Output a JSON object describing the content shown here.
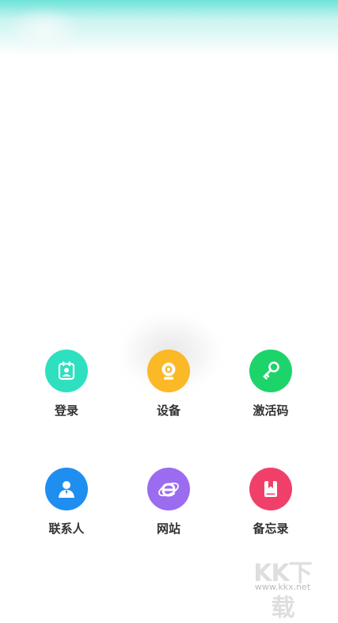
{
  "colors": {
    "login": "#2ee0c0",
    "device": "#fbb827",
    "activation": "#1dd46b",
    "contacts": "#1f8ef1",
    "website": "#9b6cf0",
    "memo": "#f0406a"
  },
  "menu": [
    {
      "id": "login",
      "label": "登录",
      "icon": "contact-card-icon"
    },
    {
      "id": "device",
      "label": "设备",
      "icon": "webcam-icon"
    },
    {
      "id": "activation",
      "label": "激活码",
      "icon": "key-icon"
    },
    {
      "id": "contacts",
      "label": "联系人",
      "icon": "person-icon"
    },
    {
      "id": "website",
      "label": "网站",
      "icon": "browser-e-icon"
    },
    {
      "id": "memo",
      "label": "备忘录",
      "icon": "book-icon"
    }
  ],
  "watermark": {
    "logo_text": "KK下载",
    "url": "www.kkx.net"
  }
}
